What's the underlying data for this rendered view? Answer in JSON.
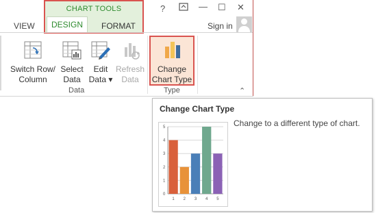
{
  "tabs": {
    "view": "VIEW",
    "contextual_title": "CHART TOOLS",
    "design": "DESIGN",
    "format": "FORMAT"
  },
  "window": {
    "help": "?",
    "ribbon_display": "⊼",
    "minimize": "—",
    "maximize": "☐",
    "close": "✕"
  },
  "account": {
    "sign_in": "Sign in"
  },
  "ribbon": {
    "data_group": {
      "label": "Data",
      "switch_row_column": [
        "Switch Row/",
        "Column"
      ],
      "select_data": [
        "Select",
        "Data"
      ],
      "edit_data": [
        "Edit",
        "Data ▾"
      ],
      "refresh_data": [
        "Refresh",
        "Data"
      ]
    },
    "type_group": {
      "label": "Type",
      "change_chart_type": [
        "Change",
        "Chart Type"
      ]
    },
    "collapse": "⌃"
  },
  "tooltip": {
    "title": "Change Chart Type",
    "description": "Change to a different type of chart."
  },
  "chart_data": {
    "type": "bar",
    "categories": [
      "1",
      "2",
      "3",
      "4",
      "5"
    ],
    "values": [
      4,
      2,
      3,
      5,
      3
    ],
    "ylim": [
      0,
      5
    ],
    "yticks": [
      "0",
      "1",
      "2",
      "3",
      "4",
      "5"
    ],
    "bar_colors": [
      "#d9603b",
      "#e8923a",
      "#4a7fb8",
      "#6fa88e",
      "#8b62b5"
    ],
    "grid": true
  },
  "colors": {
    "accent_green": "#2e8b2e",
    "highlight_red": "#d9534f",
    "highlight_fill": "#fbe5d6"
  }
}
